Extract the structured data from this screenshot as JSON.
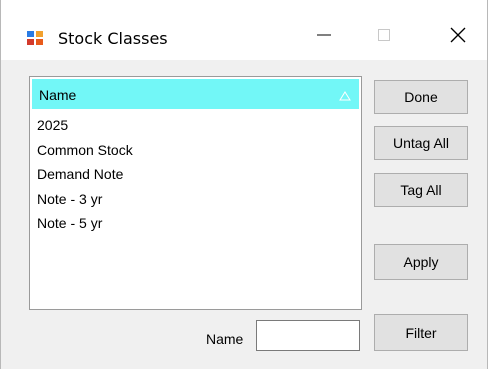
{
  "window": {
    "title": "Stock Classes",
    "controls": {
      "minimize_icon": "minimize-icon",
      "maximize_icon": "maximize-icon",
      "close_icon": "close-icon"
    }
  },
  "grid": {
    "header": {
      "column": "Name",
      "sort_icon": "sort-ascending-icon",
      "header_color": "#72f7f7"
    },
    "rows": [
      "2025",
      "Common Stock",
      "Demand Note",
      "Note - 3 yr",
      "Note - 5 yr"
    ]
  },
  "buttons": {
    "done": "Done",
    "untag_all": "Untag All",
    "tag_all": "Tag All",
    "apply": "Apply",
    "filter": "Filter"
  },
  "filter": {
    "label": "Name",
    "value": "",
    "placeholder": ""
  }
}
